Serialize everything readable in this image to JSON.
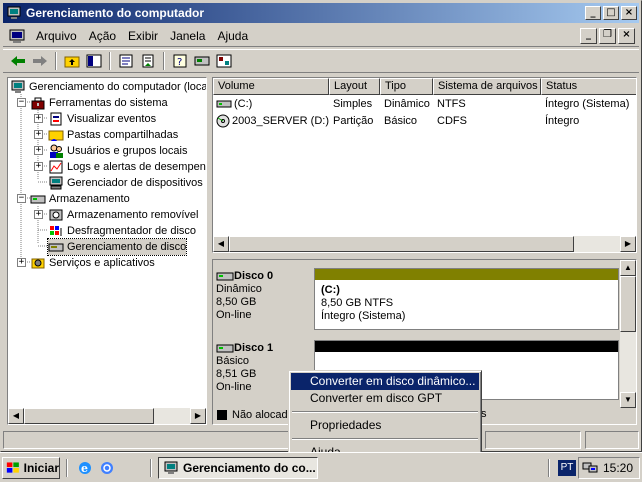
{
  "window": {
    "title": "Gerenciamento do computador",
    "icon": "computer-management-icon"
  },
  "menu": {
    "items": [
      "Arquivo",
      "Ação",
      "Exibir",
      "Janela",
      "Ajuda"
    ]
  },
  "toolbar": {
    "icons": [
      "back-arrow-icon",
      "forward-arrow-icon",
      "up-folder-icon",
      "show-hide-tree-icon",
      "properties-icon",
      "export-list-icon",
      "help-icon",
      "disk-icon",
      "settings-icon"
    ]
  },
  "tree": {
    "root": "Gerenciamento do computador (loca",
    "tools": "Ferramentas do sistema",
    "events": "Visualizar eventos",
    "shared": "Pastas compartilhadas",
    "users": "Usuários e grupos locais",
    "logs": "Logs e alertas de desempen",
    "devices": "Gerenciador de dispositivos",
    "storage": "Armazenamento",
    "removable": "Armazenamento removível",
    "defrag": "Desfragmentador de disco",
    "diskmgmt": "Gerenciamento de disco",
    "services": "Serviços e aplicativos"
  },
  "volumes": {
    "headers": {
      "volume": "Volume",
      "layout": "Layout",
      "type": "Tipo",
      "fs": "Sistema de arquivos",
      "status": "Status"
    },
    "rows": [
      {
        "volume": "(C:)",
        "layout": "Simples",
        "type": "Dinâmico",
        "fs": "NTFS",
        "status": "Íntegro (Sistema)"
      },
      {
        "volume": "2003_SERVER (D:)",
        "layout": "Partição",
        "type": "Básico",
        "fs": "CDFS",
        "status": "Íntegro"
      }
    ]
  },
  "disks": {
    "disk0": {
      "name": "Disco 0",
      "kind": "Dinâmico",
      "size": "8,50 GB",
      "state": "On-line",
      "vol_letter": "(C:)",
      "vol_size": "8,50 GB NTFS",
      "vol_status": "Íntegro (Sistema)",
      "bar_color": "#808000"
    },
    "disk1": {
      "name": "Disco 1",
      "kind": "Básico",
      "size": "8,51 GB",
      "state": "On-line",
      "bar_color": "#000000"
    }
  },
  "legend": {
    "unallocated": "Não alocad",
    "trailing": "s"
  },
  "context_menu": {
    "convert_dynamic": "Converter em disco dinâmico...",
    "convert_gpt": "Converter em disco GPT",
    "properties": "Propriedades",
    "help": "Ajuda"
  },
  "taskbar": {
    "start": "Iniciar",
    "task": "Gerenciamento do co...",
    "lang": "PT",
    "clock": "15:20"
  }
}
